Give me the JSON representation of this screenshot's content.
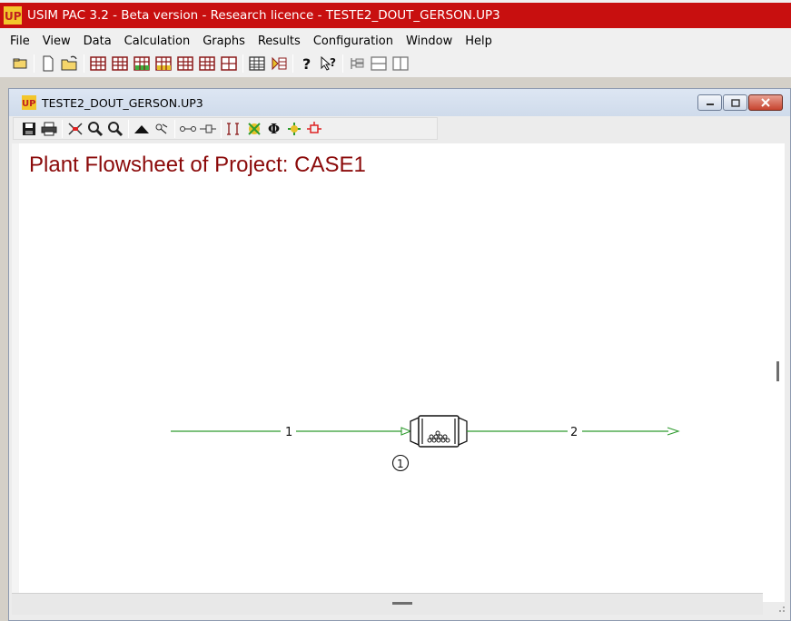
{
  "window": {
    "title": "USIM PAC 3.2 - Beta version - Research licence - TESTE2_DOUT_GERSON.UP3",
    "accent_color": "#c80f0f"
  },
  "menu": {
    "items": [
      "File",
      "View",
      "Data",
      "Calculation",
      "Graphs",
      "Results",
      "Configuration",
      "Window",
      "Help"
    ]
  },
  "toolbar": {
    "buttons": [
      {
        "name": "open-project-icon"
      },
      {
        "name": "new-document-icon"
      },
      {
        "name": "open-file-icon"
      },
      {
        "name": "table-grid-icon-1"
      },
      {
        "name": "table-grid-icon-2"
      },
      {
        "name": "table-grid-green-icon"
      },
      {
        "name": "table-grid-yellow-icon"
      },
      {
        "name": "table-grid-icon-3"
      },
      {
        "name": "table-grid-icon-4"
      },
      {
        "name": "table-grid-icon-5"
      },
      {
        "name": "spreadsheet-icon"
      },
      {
        "name": "data-entry-icon"
      },
      {
        "name": "help-icon"
      },
      {
        "name": "context-help-icon"
      },
      {
        "name": "tree-view-icon"
      },
      {
        "name": "horizontal-split-icon"
      },
      {
        "name": "vertical-split-icon"
      }
    ]
  },
  "child_window": {
    "title": "TESTE2_DOUT_GERSON.UP3",
    "toolbar": [
      "save-icon",
      "print-icon",
      "zoom-fit-icon",
      "zoom-in-icon",
      "zoom-out-icon",
      "mountain-icon",
      "node-icon",
      "stream-line-icon",
      "stream-arrow-icon",
      "bracket-icon",
      "unit-green-icon",
      "phi-icon",
      "unit-yellow-icon",
      "unit-link-icon"
    ]
  },
  "flowsheet": {
    "heading": "Plant Flowsheet of Project: CASE1",
    "streams": [
      {
        "id": "1"
      },
      {
        "id": "2"
      }
    ],
    "units": [
      {
        "id": "1"
      }
    ],
    "stream_color": "#2e9b2e",
    "heading_color": "#8b0a0a"
  }
}
